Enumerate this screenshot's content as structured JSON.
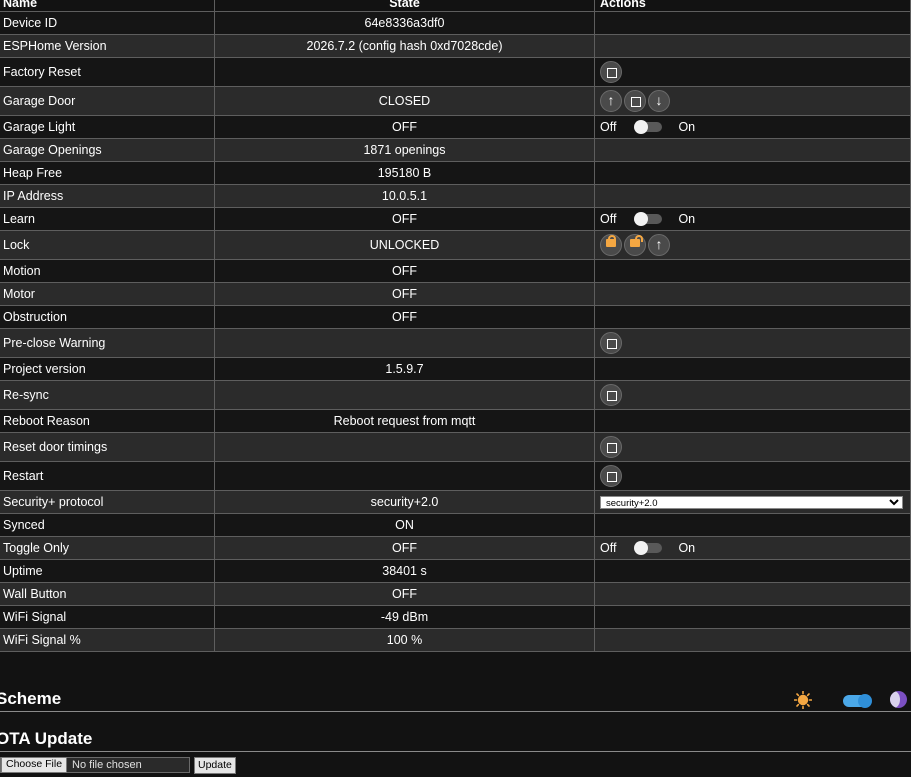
{
  "table": {
    "headers": {
      "name": "Name",
      "state": "State",
      "actions": "Actions"
    },
    "rows": [
      {
        "name": "Device ID",
        "state": "64e8336a3df0"
      },
      {
        "name": "ESPHome Version",
        "state": "2026.7.2 (config hash 0xd7028cde)"
      },
      {
        "name": "Factory Reset",
        "state": ""
      },
      {
        "name": "Garage Door",
        "state": "CLOSED"
      },
      {
        "name": "Garage Light",
        "state": "OFF"
      },
      {
        "name": "Garage Openings",
        "state": "1871 openings"
      },
      {
        "name": "Heap Free",
        "state": "195180 B"
      },
      {
        "name": "IP Address",
        "state": "10.0.5.1"
      },
      {
        "name": "Learn",
        "state": "OFF"
      },
      {
        "name": "Lock",
        "state": "UNLOCKED"
      },
      {
        "name": "Motion",
        "state": "OFF"
      },
      {
        "name": "Motor",
        "state": "OFF"
      },
      {
        "name": "Obstruction",
        "state": "OFF"
      },
      {
        "name": "Pre-close Warning",
        "state": ""
      },
      {
        "name": "Project version",
        "state": "1.5.9.7"
      },
      {
        "name": "Re-sync",
        "state": ""
      },
      {
        "name": "Reboot Reason",
        "state": "Reboot request from mqtt"
      },
      {
        "name": "Reset door timings",
        "state": ""
      },
      {
        "name": "Restart",
        "state": ""
      },
      {
        "name": "Security+ protocol",
        "state": "security+2.0"
      },
      {
        "name": "Synced",
        "state": "ON"
      },
      {
        "name": "Toggle Only",
        "state": "OFF"
      },
      {
        "name": "Uptime",
        "state": "38401 s"
      },
      {
        "name": "Wall Button",
        "state": "OFF"
      },
      {
        "name": "WiFi Signal",
        "state": "-49 dBm"
      },
      {
        "name": "WiFi Signal %",
        "state": "100 %"
      }
    ],
    "switch": {
      "off_label": "Off",
      "on_label": "On"
    },
    "garage_door_buttons": {
      "open": "↑",
      "down": "↓"
    },
    "lock_buttons": {
      "open": "↑"
    },
    "protocol_select": {
      "selected": "security+2.0"
    }
  },
  "scheme": {
    "title": "Scheme"
  },
  "ota": {
    "title": "OTA Update",
    "choose_file": "Choose File",
    "no_file": "No file chosen",
    "update": "Update"
  },
  "colors": {
    "background": "#121212",
    "row_even": "#2b2b2b",
    "row_odd": "#151515",
    "accent_orange": "#f4a742",
    "accent_blue": "#4ba8e8",
    "accent_purple": "#7b4fc2"
  }
}
